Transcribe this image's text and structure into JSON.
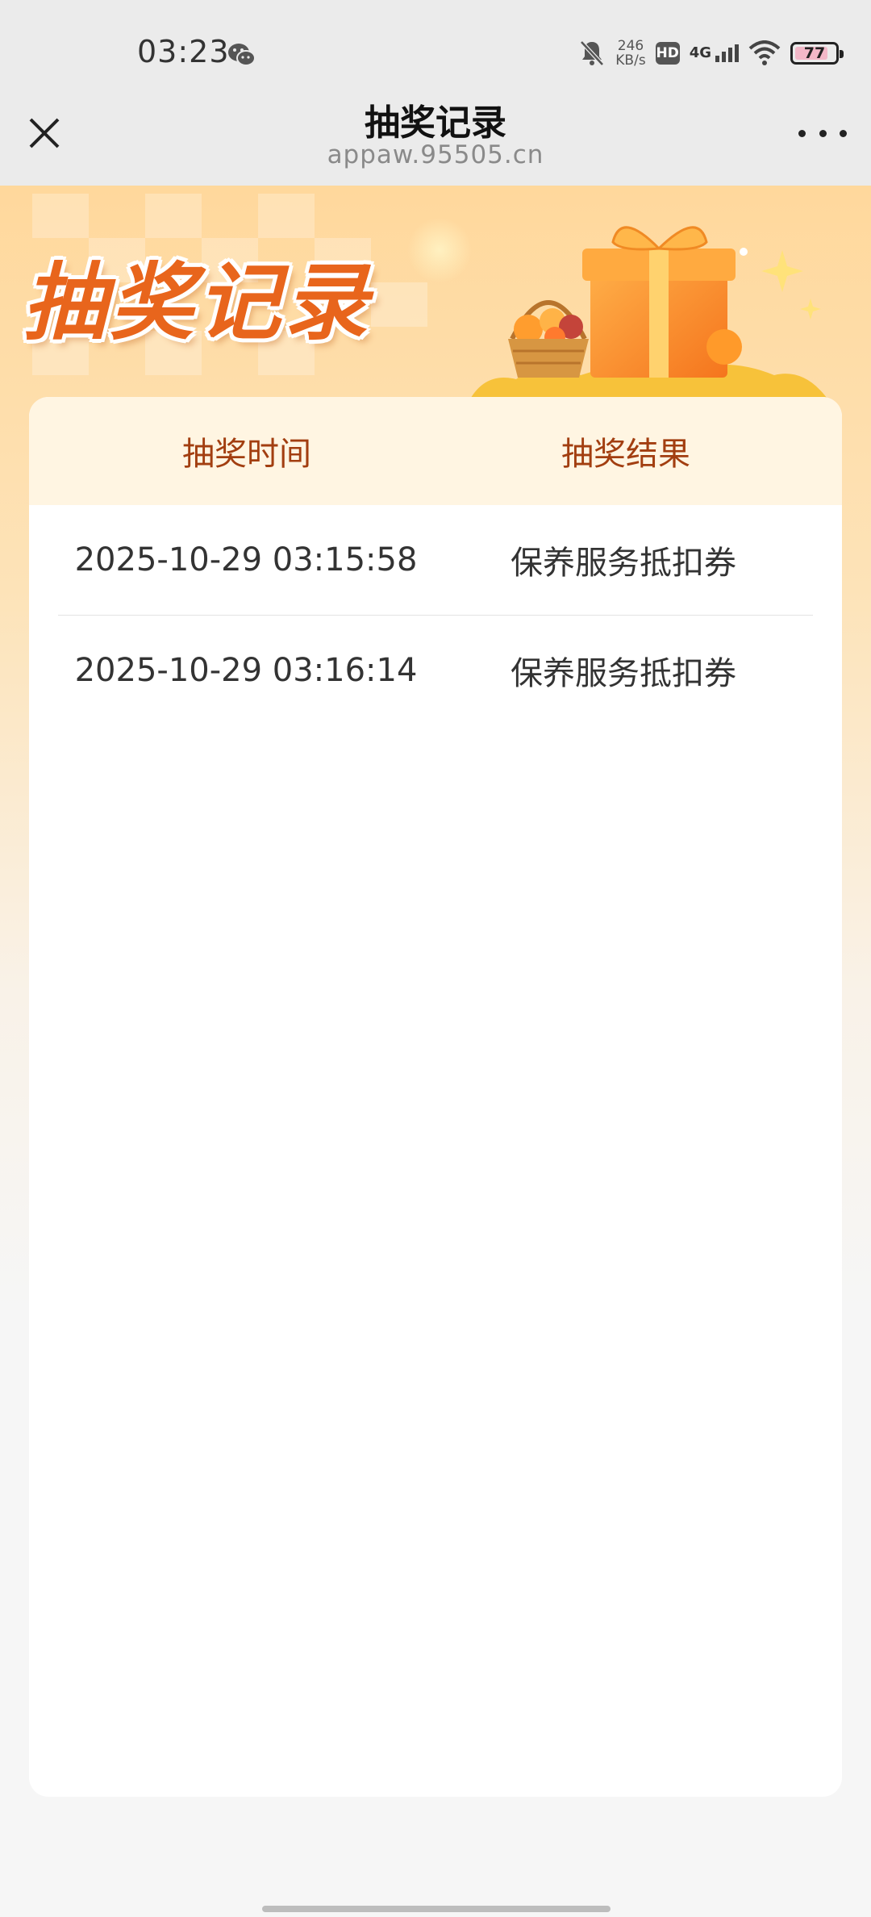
{
  "status_bar": {
    "time": "03:23",
    "net_speed_value": "246",
    "net_speed_unit": "KB/s",
    "hd_label": "HD",
    "network_label": "4G",
    "battery_level": "77"
  },
  "nav": {
    "title": "抽奖记录",
    "subtitle": "appaw.95505.cn"
  },
  "banner": {
    "title": "抽奖记录"
  },
  "table": {
    "headers": [
      "抽奖时间",
      "抽奖结果"
    ],
    "rows": [
      {
        "time": "2025-10-29 03:15:58",
        "result": "保养服务抵扣券"
      },
      {
        "time": "2025-10-29 03:16:14",
        "result": "保养服务抵扣券"
      }
    ]
  },
  "colors": {
    "accent": "#e8651c",
    "header_text": "#a23e10",
    "header_bg": "#fff5e2"
  }
}
